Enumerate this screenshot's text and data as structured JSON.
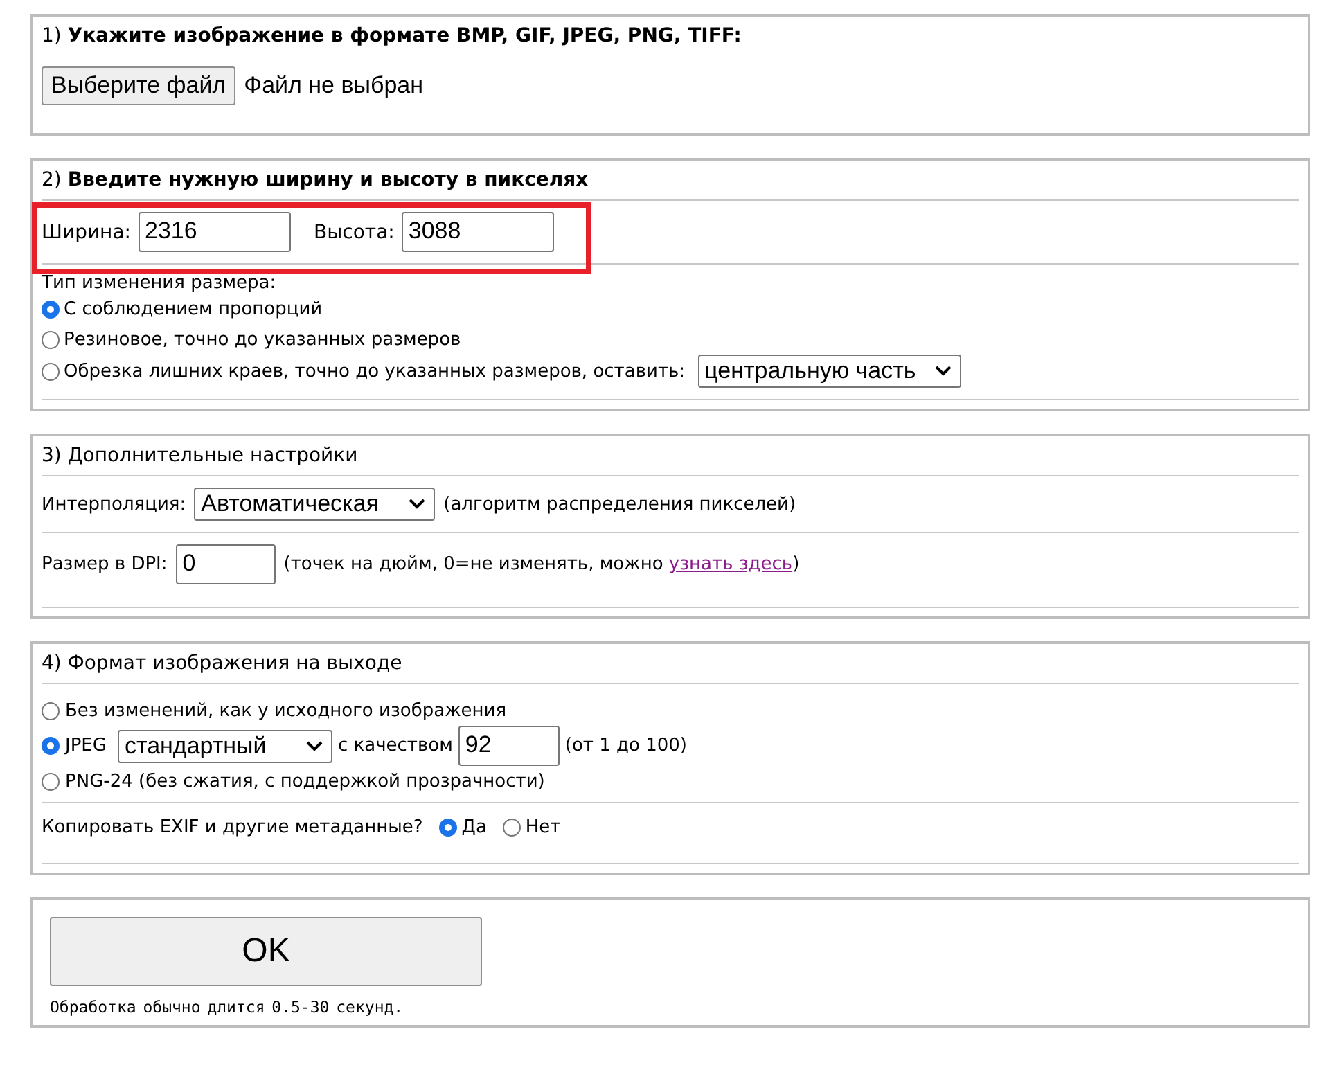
{
  "section_1": {
    "title": "1) **Укажите изображение в формате BMP, GIF, JPEG, PNG, TIFF:**",
    "file_button": "Выберите файл",
    "file_status": "Файл не выбран"
  },
  "section_2": {
    "title": "2) **Введите нужную ширину и высоту в пикселях**",
    "highlighted": true,
    "width_label": "Ширина:",
    "width_value": "2316",
    "height_label": "Высота:",
    "height_value": "3088",
    "resize_label": "Тип изменения размера:",
    "resize_options": [
      {
        "label": "С соблюдением пропорций",
        "selected": true
      },
      {
        "label": "Резиновое, точно до указанных размеров",
        "selected": false
      },
      {
        "label": "Обрезка лишних краев, точно до указанных размеров, оставить:",
        "selected": false,
        "select_value": "центральную часть"
      }
    ]
  },
  "section_3": {
    "title": "3) Дополнительные настройки",
    "interpolation_label": "Интерполяция:",
    "interpolation_value": "Автоматическая",
    "interpolation_note": "(алгоритм распределения пикселей)",
    "dpi_label": "Размер в DPI:",
    "dpi_value": "0",
    "dpi_note": "(точек на дюйм, 0=не изменять, можно",
    "dpi_link": "узнать здесь",
    "dpi_note_end": ")"
  },
  "section_4": {
    "title": "4) Формат изображения на выходе",
    "format_options": [
      {
        "kind": "plain",
        "label": "Без изменений, как у исходного изображения",
        "selected": false
      },
      {
        "kind": "jpeg",
        "label": "JPEG",
        "selected": true,
        "select_value": "стандартный",
        "quality_label": "с качеством",
        "quality_value": "92",
        "quality_note": "(от 1 до 100)"
      },
      {
        "kind": "plain",
        "label": "PNG-24 (без сжатия, с поддержкой прозрачности)",
        "selected": false
      }
    ],
    "exif_label": "Копировать EXIF и другие метаданные?",
    "exif_options": [
      {
        "label": "Да",
        "selected": true
      },
      {
        "label": "Нет",
        "selected": false
      }
    ]
  },
  "section_5": {
    "ok_button": "OK",
    "note": "Обработка обычно длится 0.5-30 секунд."
  }
}
